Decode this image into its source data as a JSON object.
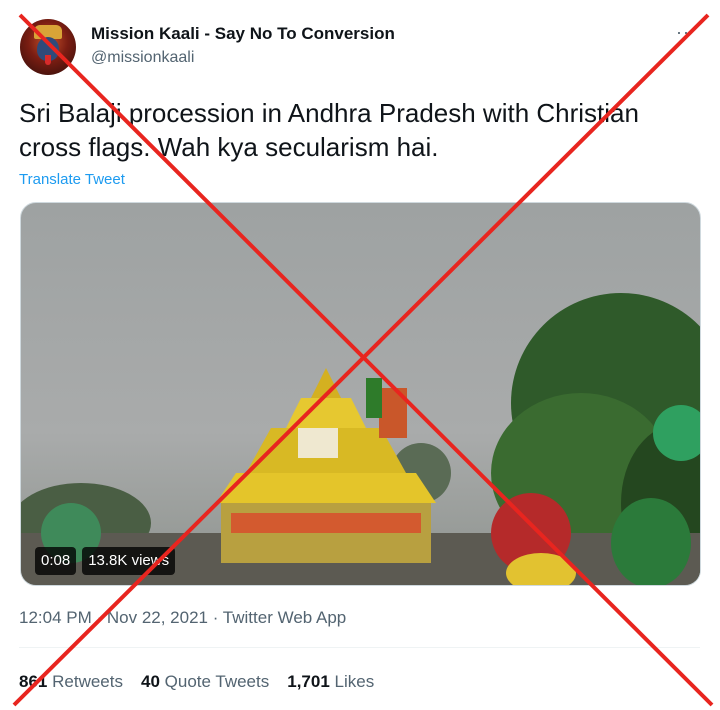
{
  "author": {
    "display_name": "Mission Kaali - Say No To Conversion",
    "handle": "@missionkaali",
    "avatar_icon": "goddess-kaali-avatar"
  },
  "more_label": "··",
  "tweet": {
    "text": "Sri Balaji procession in Andhra Pradesh with Christian cross flags. Wah kya secularism hai.",
    "translate_label": "Translate Tweet"
  },
  "video": {
    "duration": "0:08",
    "views": "13.8K views"
  },
  "meta": "12:04 PM · Nov 22, 2021 · Twitter Web App",
  "stats": {
    "retweets_count": "861",
    "retweets_label": "Retweets",
    "quotes_count": "40",
    "quotes_label": "Quote Tweets",
    "likes_count": "1,701",
    "likes_label": "Likes"
  },
  "colors": {
    "link": "#1d9bf0",
    "secondary_text": "#536471",
    "cross_overlay": "#e8251f"
  }
}
